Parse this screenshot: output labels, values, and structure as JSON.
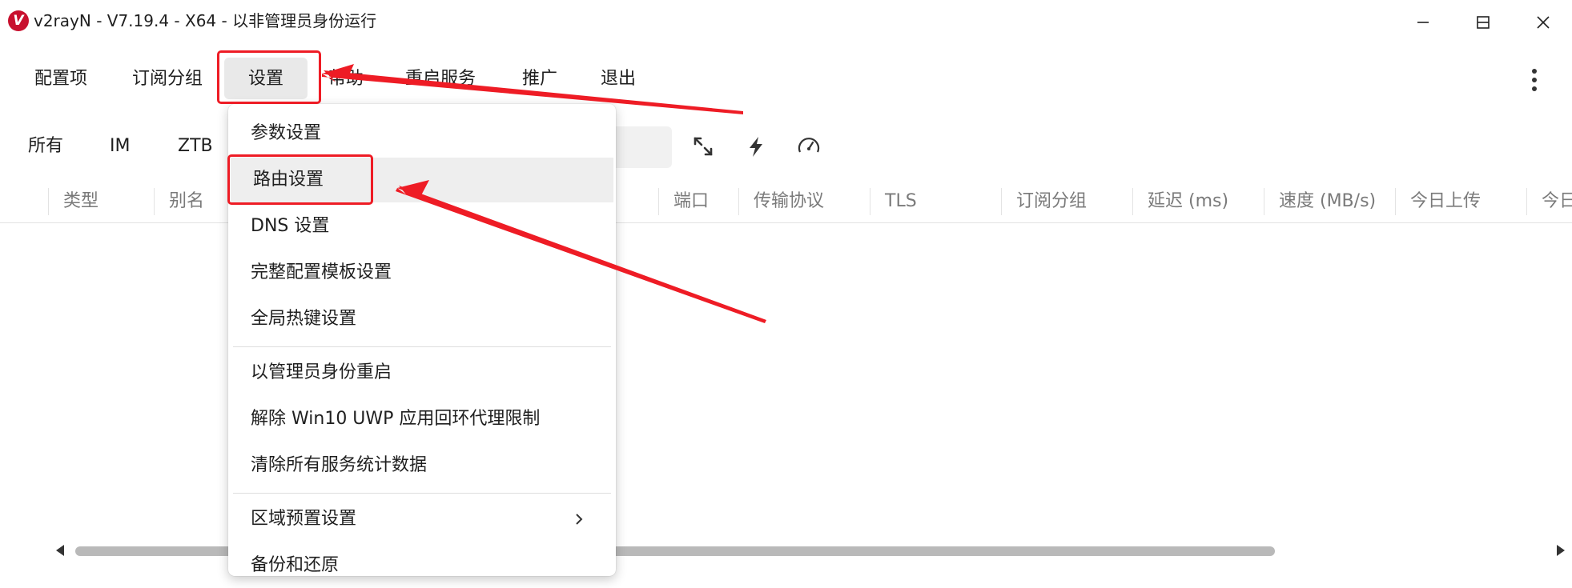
{
  "window": {
    "title": "v2rayN - V7.19.4 - X64 - 以非管理员身份运行",
    "logo_letter": "V",
    "controls": [
      "minimize-icon",
      "maximize-icon",
      "close-icon"
    ]
  },
  "menu": {
    "items": [
      "配置项",
      "订阅分组",
      "设置",
      "帮助",
      "重启服务",
      "推广",
      "退出"
    ],
    "overflow_icon": "more-vertical-icon"
  },
  "filters": {
    "tabs": [
      "所有",
      "IM",
      "ZTB"
    ],
    "tool_icons": [
      "expand-icon",
      "lightning-icon",
      "speedometer-icon"
    ]
  },
  "table": {
    "columns": [
      "类型",
      "别名",
      "端口",
      "传输协议",
      "TLS",
      "订阅分组",
      "延迟 (ms)",
      "速度 (MB/s)",
      "今日上传",
      "今日下载"
    ]
  },
  "dropdown": {
    "items": [
      {
        "label": "参数设置"
      },
      {
        "label": "路由设置"
      },
      {
        "label": "DNS 设置"
      },
      {
        "label": "完整配置模板设置"
      },
      {
        "label": "全局热键设置"
      },
      {
        "label": "以管理员身份重启"
      },
      {
        "label": "解除 Win10 UWP 应用回环代理限制"
      },
      {
        "label": "清除所有服务统计数据"
      },
      {
        "label": "区域预置设置"
      },
      {
        "label": "备份和还原"
      }
    ],
    "submenu_icon": "chevron-right-icon"
  },
  "annotation": {
    "color": "#ee1c25"
  },
  "colors": {
    "logo": "#c8102e",
    "hover": "#eeeeee",
    "header_text": "#7a7a7a"
  }
}
